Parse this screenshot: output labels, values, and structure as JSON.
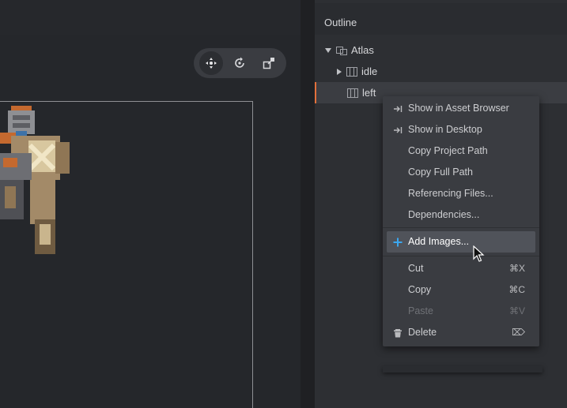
{
  "outline": {
    "title": "Outline",
    "tree": [
      {
        "label": "Atlas",
        "expanded": true,
        "icon": "atlas-icon"
      },
      {
        "label": "idle",
        "expanded": false,
        "icon": "animation-icon"
      },
      {
        "label": "left",
        "selected": true,
        "icon": "animation-icon"
      }
    ]
  },
  "toolbar": {
    "tools": [
      "move-tool-icon",
      "rotate-tool-icon",
      "scale-tool-icon"
    ],
    "active": "move-tool-icon"
  },
  "context_menu": {
    "items": [
      {
        "label": "Show in Asset Browser",
        "icon": "reveal-icon",
        "shortcut": ""
      },
      {
        "label": "Show in Desktop",
        "icon": "reveal-icon",
        "shortcut": ""
      },
      {
        "label": "Copy Project Path",
        "icon": "",
        "shortcut": ""
      },
      {
        "label": "Copy Full Path",
        "icon": "",
        "shortcut": ""
      },
      {
        "label": "Referencing Files...",
        "icon": "",
        "shortcut": ""
      },
      {
        "label": "Dependencies...",
        "icon": "",
        "shortcut": ""
      },
      {
        "label": "Add Images...",
        "icon": "plus-icon",
        "shortcut": "",
        "hover": true
      },
      {
        "label": "Cut",
        "icon": "",
        "shortcut": "⌘X"
      },
      {
        "label": "Copy",
        "icon": "",
        "shortcut": "⌘C"
      },
      {
        "label": "Paste",
        "icon": "",
        "shortcut": "⌘V",
        "disabled": true
      },
      {
        "label": "Delete",
        "icon": "trash-icon",
        "shortcut": "⌦"
      }
    ]
  },
  "colors": {
    "accent_selection": "#e3703b",
    "plus_icon": "#3ba7f0"
  }
}
